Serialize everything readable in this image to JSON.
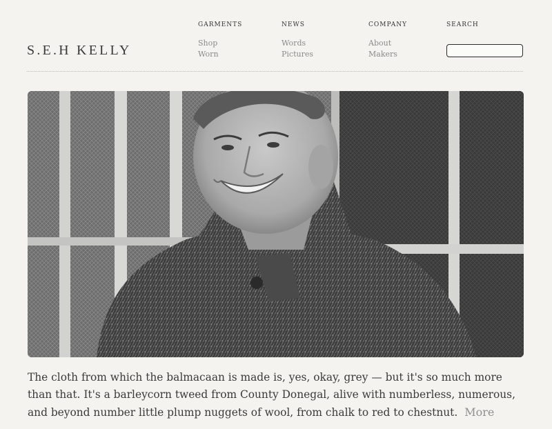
{
  "brand": {
    "logo_text": "S.E.H KELLY"
  },
  "nav": {
    "garments": {
      "heading": "GARMENTS",
      "links": [
        "Shop",
        "Worn"
      ]
    },
    "news": {
      "heading": "NEWS",
      "links": [
        "Words",
        "Pictures"
      ]
    },
    "company": {
      "heading": "COMPANY",
      "links": [
        "About",
        "Makers"
      ]
    },
    "search": {
      "heading": "SEARCH",
      "value": "",
      "placeholder": ""
    }
  },
  "hero": {
    "alt": "Smiling man wearing a grey herringbone tweed balmacaan coat"
  },
  "caption": {
    "text": "The cloth from which the balmacaan is made is, yes, okay, grey — but it's so much more than that. It's a barleycorn tweed from County Donegal, alive with numberless, numerous, and beyond number little plump nuggets of wool, from chalk to red to chestnut.",
    "more_label": "More"
  },
  "colors": {
    "background": "#f4f3ef",
    "text": "#3a3a3a",
    "muted": "#8a8a8a"
  }
}
